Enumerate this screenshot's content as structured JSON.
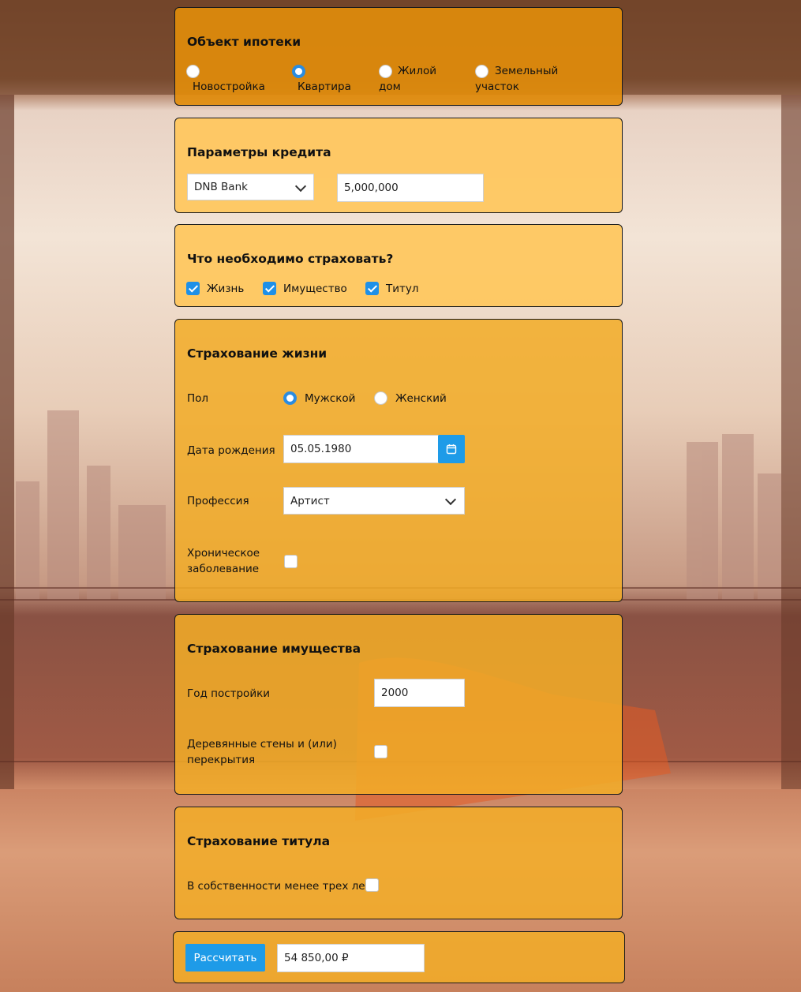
{
  "mortgage_object": {
    "title": "Объект ипотеки",
    "options": [
      {
        "label": "Новостройка",
        "selected": false
      },
      {
        "label": "Квартира",
        "selected": true
      },
      {
        "label": "Жилой дом",
        "line1": "Жилой",
        "line2": "дом",
        "selected": false
      },
      {
        "label": "Земельный участок",
        "line1": "Земельный",
        "line2": "участок",
        "selected": false
      }
    ]
  },
  "credit": {
    "title": "Параметры кредита",
    "bank_value": "DNB Bank",
    "amount_value": "5,000,000"
  },
  "insure_what": {
    "title": "Что необходимо страховать?",
    "options": [
      {
        "label": "Жизнь",
        "checked": true
      },
      {
        "label": "Имущество",
        "checked": true
      },
      {
        "label": "Титул",
        "checked": true
      }
    ]
  },
  "life": {
    "title": "Страхование жизни",
    "gender_label": "Пол",
    "gender_options": [
      {
        "label": "Мужской",
        "selected": true
      },
      {
        "label": "Женский",
        "selected": false
      }
    ],
    "birthdate_label": "Дата рождения",
    "birthdate_value": "05.05.1980",
    "profession_label": "Профессия",
    "profession_value": "Артист",
    "chronic_label_1": "Хроническое",
    "chronic_label_2": "заболевание",
    "chronic_checked": false
  },
  "property": {
    "title": "Страхование имущества",
    "year_label": "Год постройки",
    "year_value": "2000",
    "wooden_label_1": "Деревянные стены и (или)",
    "wooden_label_2": "перекрытия",
    "wooden_checked": false
  },
  "title_ins": {
    "title": "Страхование титула",
    "owned_label": "В собственности менее трех лет",
    "owned_checked": false
  },
  "footer": {
    "calculate_label": "Рассчитать",
    "result_value": "54 850,00 ₽"
  },
  "colors": {
    "accent": "#1e9be8",
    "card_orange": "#e28d0a",
    "card_yellow": "#ffc75c"
  }
}
